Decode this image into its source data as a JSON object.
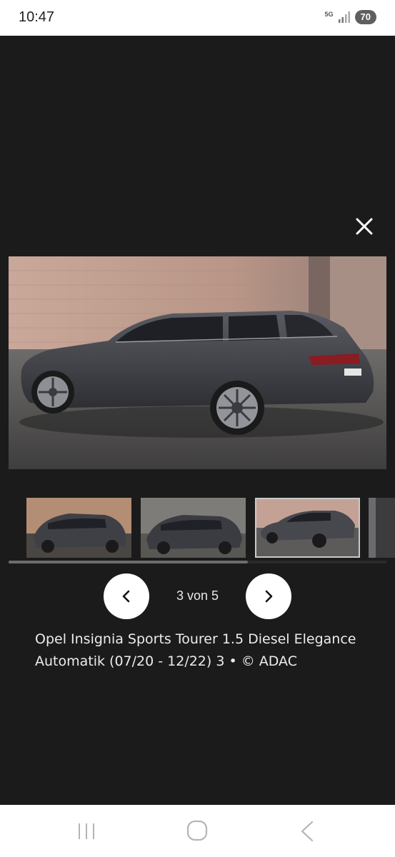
{
  "status_bar": {
    "time": "10:47",
    "network": "5G",
    "battery": "70"
  },
  "gallery": {
    "close_label": "close",
    "counter": "3 von 5",
    "caption": "Opel Insignia Sports Tourer 1.5 Diesel Elegance Automatik (07/20 - 12/22) 3 • © ADAC",
    "current_index": 3,
    "total": 5
  },
  "colors": {
    "background": "#1b1b1b",
    "car_body": "#4a4a4f",
    "brand_accent": "#ffffff"
  },
  "icons": {
    "close": "close-icon",
    "prev": "chevron-left-icon",
    "next": "chevron-right-icon",
    "nav_recents": "recents-icon",
    "nav_home": "home-icon",
    "nav_back": "back-icon"
  }
}
